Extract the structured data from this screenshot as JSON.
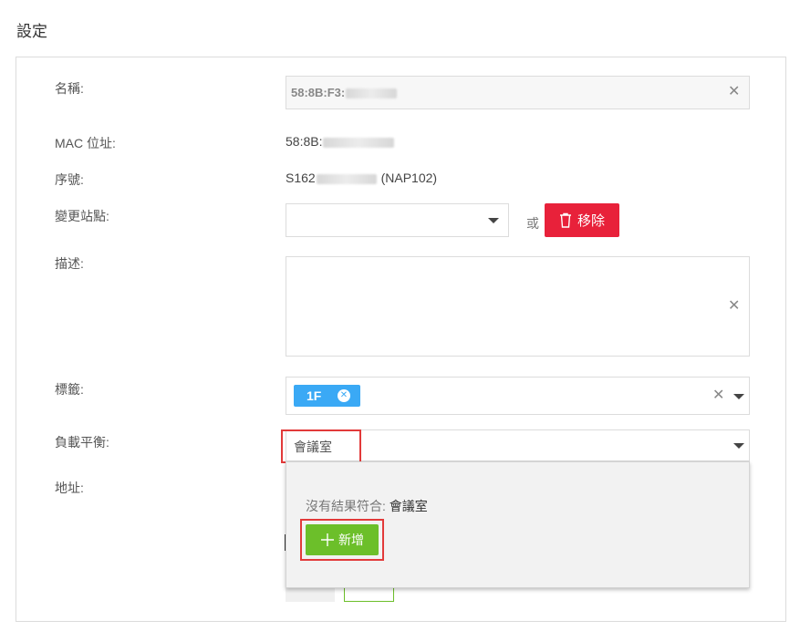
{
  "page": {
    "title": "設定"
  },
  "fields": {
    "name": {
      "label": "名稱:",
      "value": "58:8B:F3:"
    },
    "mac": {
      "label": "MAC 位址:",
      "value": "58:8B:"
    },
    "serial": {
      "label": "序號:",
      "value_prefix": "S162",
      "value_suffix": " (NAP102)"
    },
    "site": {
      "label": "變更站點:",
      "value": ""
    },
    "or_text": "或",
    "remove_button": "移除",
    "description": {
      "label": "描述:",
      "value": ""
    },
    "tags": {
      "label": "標籤:",
      "items": [
        "1F"
      ]
    },
    "load_balance": {
      "label": "負載平衡:",
      "value": "會議室"
    },
    "address": {
      "label": "地址:"
    }
  },
  "dropdown": {
    "no_result_prefix": "沒有結果符合: ",
    "no_result_term": "會議室",
    "add_button": "新增"
  },
  "colors": {
    "remove": "#e8213a",
    "add": "#6cbf2a",
    "tag": "#3aa9f5",
    "highlight": "#e23a3a"
  }
}
